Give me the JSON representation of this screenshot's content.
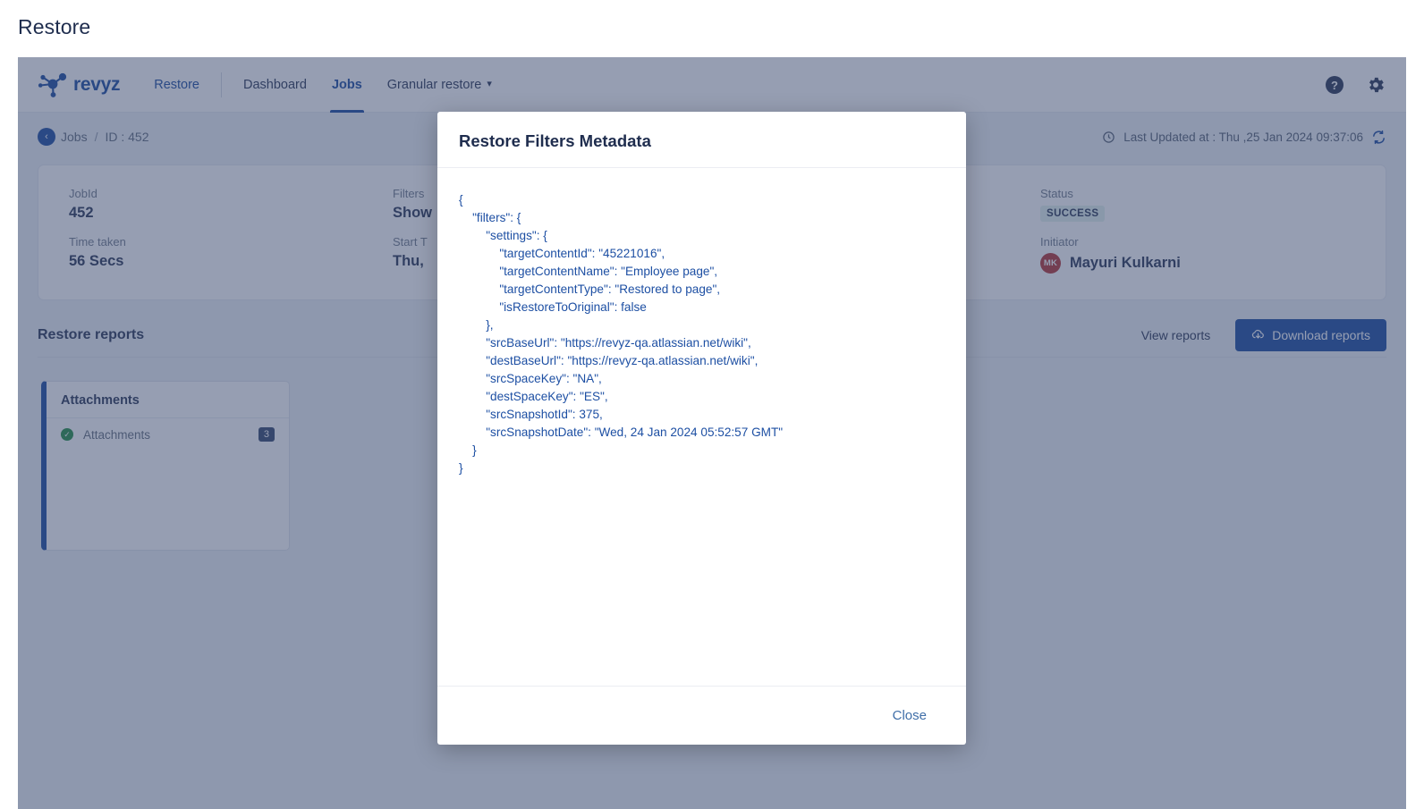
{
  "page": {
    "heading": "Restore"
  },
  "navbar": {
    "brand": "revyz",
    "links": [
      {
        "label": "Restore",
        "state": "link"
      },
      {
        "label": "Dashboard",
        "state": "dark"
      },
      {
        "label": "Jobs",
        "state": "active"
      },
      {
        "label": "Granular restore",
        "state": "dark",
        "caret": "⌄"
      }
    ],
    "help_icon": "help-circle-icon",
    "settings_icon": "gear-icon"
  },
  "breadcrumb": {
    "back_icon": "‹",
    "parent": "Jobs",
    "separator": "/",
    "current": "ID : 452",
    "last_updated": "Last Updated at : Thu ,25 Jan 2024 09:37:06",
    "clock_icon": "clock-icon",
    "refresh_icon": "refresh-icon"
  },
  "summary": {
    "jobid_label": "JobId",
    "jobid_value": "452",
    "filters_label": "Filters",
    "filters_value": "Show",
    "status_label": "Status",
    "status_value": "SUCCESS",
    "time_taken_label": "Time taken",
    "time_taken_value": "56 Secs",
    "start_time_label": "Start T",
    "start_time_value": "Thu,",
    "initiator_label": "Initiator",
    "initiator_initials": "MK",
    "initiator_name": "Mayuri Kulkarni"
  },
  "reports": {
    "title": "Restore reports",
    "view_label": "View reports",
    "download_label": "Download reports",
    "download_icon": "cloud-download-icon",
    "cards": [
      {
        "title": "Attachments",
        "row_label": "Attachments",
        "row_count": "3",
        "status_icon": "check-circle-icon"
      }
    ]
  },
  "modal": {
    "title": "Restore Filters Metadata",
    "close_label": "Close",
    "json_text": "{\n    \"filters\": {\n        \"settings\": {\n            \"targetContentId\": \"45221016\",\n            \"targetContentName\": \"Employee page\",\n            \"targetContentType\": \"Restored to page\",\n            \"isRestoreToOriginal\": false\n        },\n        \"srcBaseUrl\": \"https://revyz-qa.atlassian.net/wiki\",\n        \"destBaseUrl\": \"https://revyz-qa.atlassian.net/wiki\",\n        \"srcSpaceKey\": \"NA\",\n        \"destSpaceKey\": \"ES\",\n        \"srcSnapshotId\": 375,\n        \"srcSnapshotDate\": \"Wed, 24 Jan 2024 05:52:57 GMT\"\n    }\n}"
  },
  "colors": {
    "brand_blue": "#11449b",
    "overlay": "#3f4f72",
    "success_bg": "#e2f2ee",
    "avatar_red": "#b12c2c",
    "check_green": "#1a8a3c",
    "chip_navy": "#2c3e66"
  }
}
